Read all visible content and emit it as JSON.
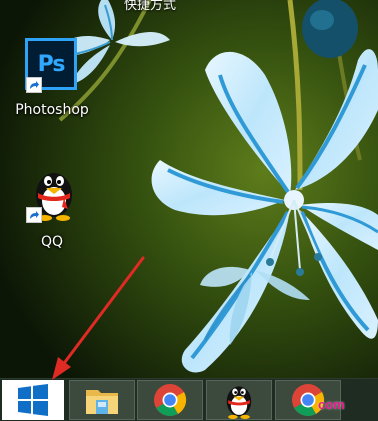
{
  "desktop": {
    "top_label": "快捷方式",
    "icons": [
      {
        "label": "Photoshop",
        "app_text": "Ps",
        "icon": "photoshop-icon"
      },
      {
        "label": "QQ",
        "icon": "qq-penguin-icon"
      }
    ]
  },
  "taskbar": {
    "start_icon": "windows-logo-icon",
    "items": [
      {
        "icon": "file-explorer-icon"
      },
      {
        "icon": "chrome-icon"
      },
      {
        "icon": "qq-penguin-icon"
      },
      {
        "icon": "chrome-icon"
      }
    ]
  },
  "watermark": "com",
  "colors": {
    "annotation_arrow": "#e02a24",
    "taskbar": "#1f2c21",
    "flower_blue": "#3fa6db",
    "photoshop_accent": "#31a8ff"
  }
}
